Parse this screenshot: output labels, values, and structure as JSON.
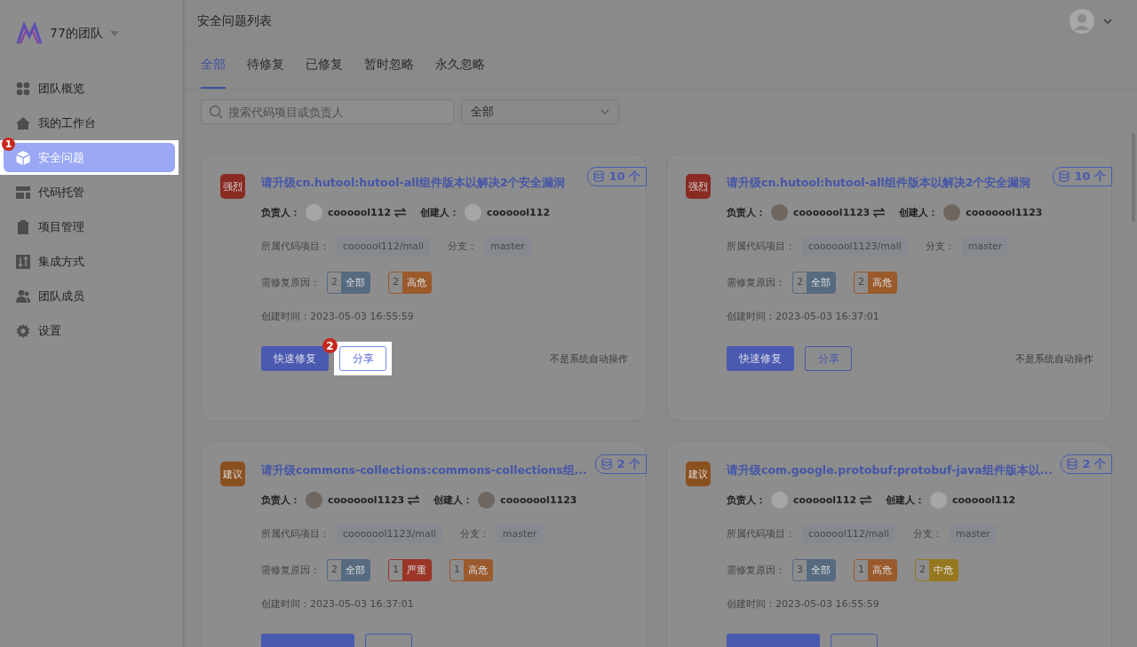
{
  "team": {
    "name": "77的团队"
  },
  "sidebar": {
    "items": [
      {
        "label": "团队概览",
        "selected": false,
        "highlighted": false
      },
      {
        "label": "我的工作台",
        "selected": false,
        "highlighted": false
      },
      {
        "label": "安全问题",
        "selected": true,
        "highlighted": true,
        "step": "1"
      },
      {
        "label": "代码托管",
        "selected": false,
        "highlighted": false
      },
      {
        "label": "项目管理",
        "selected": false,
        "highlighted": false
      },
      {
        "label": "集成方式",
        "selected": false,
        "highlighted": false
      },
      {
        "label": "团队成员",
        "selected": false,
        "highlighted": false
      },
      {
        "label": "设置",
        "selected": false,
        "highlighted": false
      }
    ]
  },
  "header": {
    "title": "安全问题列表"
  },
  "tabs": [
    {
      "label": "全部",
      "selected": true
    },
    {
      "label": "待修复",
      "selected": false
    },
    {
      "label": "已修复",
      "selected": false
    },
    {
      "label": "暂时忽略",
      "selected": false
    },
    {
      "label": "永久忽略",
      "selected": false
    }
  ],
  "search": {
    "placeholder": "搜索代码项目或负责人"
  },
  "filter": {
    "value": "全部"
  },
  "cards": [
    {
      "severity": {
        "label": "强烈",
        "kind": "strong"
      },
      "title": "请升级cn.hutool:hutool-all组件版本以解决2个安全漏洞",
      "count": "10 个",
      "assignee": {
        "label": "负责人：",
        "name": "coooool112",
        "kind": "default"
      },
      "creator": {
        "label": "创建人：",
        "name": "coooool112",
        "kind": "default"
      },
      "project_label": "所属代码项目：",
      "project": "coooool112/mall",
      "branch_label": "分支：",
      "branch": "master",
      "reasons_label": "需修复原因：",
      "reasons": [
        {
          "count": "2",
          "label": "全部",
          "kind": "all"
        },
        {
          "count": "2",
          "label": "高危",
          "kind": "high"
        }
      ],
      "created": "创建时间：2023-05-03 16:55:59",
      "actions": {
        "fix": "快速修复",
        "share": "分享",
        "share_highlighted": true,
        "step": "2",
        "note": "不是系统自动操作"
      }
    },
    {
      "severity": {
        "label": "强烈",
        "kind": "strong"
      },
      "title": "请升级cn.hutool:hutool-all组件版本以解决2个安全漏洞",
      "count": "10 个",
      "assignee": {
        "label": "负责人：",
        "name": "cooooool1123",
        "kind": "photo"
      },
      "creator": {
        "label": "创建人：",
        "name": "cooooool1123",
        "kind": "photo"
      },
      "project_label": "所属代码项目：",
      "project": "cooooool1123/mall",
      "branch_label": "分支：",
      "branch": "master",
      "reasons_label": "需修复原因：",
      "reasons": [
        {
          "count": "2",
          "label": "全部",
          "kind": "all"
        },
        {
          "count": "2",
          "label": "高危",
          "kind": "high"
        }
      ],
      "created": "创建时间：2023-05-03 16:37:01",
      "actions": {
        "fix": "快速修复",
        "share": "分享",
        "share_highlighted": false,
        "note": "不是系统自动操作"
      }
    },
    {
      "severity": {
        "label": "建议",
        "kind": "suggest"
      },
      "title": "请升级commons-collections:commons-collections组...",
      "count": "2 个",
      "assignee": {
        "label": "负责人：",
        "name": "cooooool1123",
        "kind": "photo"
      },
      "creator": {
        "label": "创建人：",
        "name": "cooooool1123",
        "kind": "photo"
      },
      "project_label": "所属代码项目：",
      "project": "cooooool1123/mall",
      "branch_label": "分支：",
      "branch": "master",
      "reasons_label": "需修复原因：",
      "reasons": [
        {
          "count": "2",
          "label": "全部",
          "kind": "all"
        },
        {
          "count": "1",
          "label": "严重",
          "kind": "serious"
        },
        {
          "count": "1",
          "label": "高危",
          "kind": "high"
        }
      ],
      "created": "创建时间：2023-05-03 16:37:01"
    },
    {
      "severity": {
        "label": "建议",
        "kind": "suggest"
      },
      "title": "请升级com.google.protobuf:protobuf-java组件版本以...",
      "count": "2 个",
      "assignee": {
        "label": "负责人：",
        "name": "coooool112",
        "kind": "default"
      },
      "creator": {
        "label": "创建人：",
        "name": "coooool112",
        "kind": "default"
      },
      "project_label": "所属代码项目：",
      "project": "coooool112/mall",
      "branch_label": "分支：",
      "branch": "master",
      "reasons_label": "需修复原因：",
      "reasons": [
        {
          "count": "3",
          "label": "全部",
          "kind": "all"
        },
        {
          "count": "1",
          "label": "高危",
          "kind": "high"
        },
        {
          "count": "2",
          "label": "中危",
          "kind": "medium"
        }
      ],
      "created": "创建时间：2023-05-03 16:55:59"
    }
  ]
}
